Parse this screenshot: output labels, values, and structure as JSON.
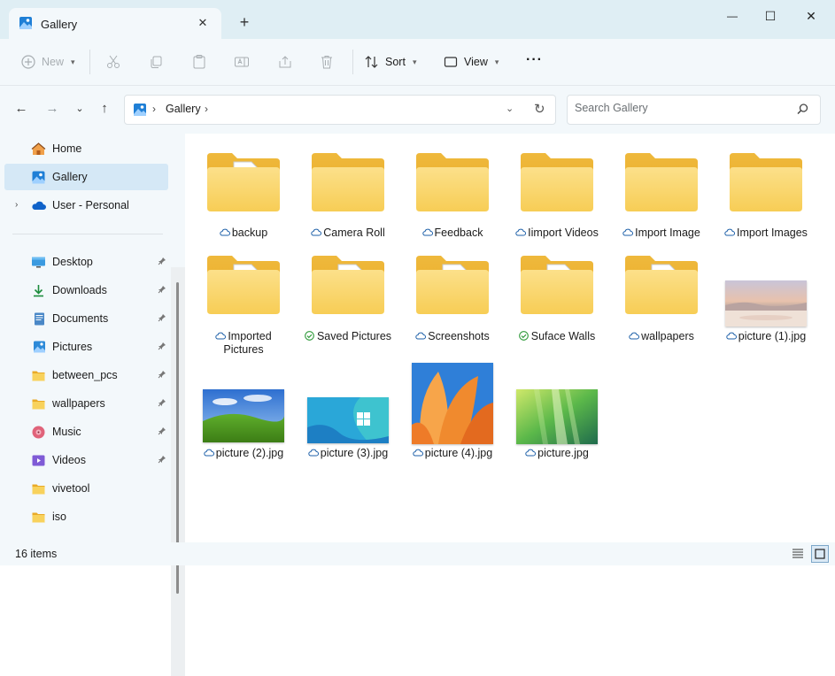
{
  "window": {
    "tab_title": "Gallery",
    "new_tab_glyph": "+",
    "close_tab_glyph": "✕",
    "minimize_glyph": "—",
    "maximize_glyph": "☐",
    "close_glyph": "✕"
  },
  "toolbar": {
    "new_label": "New",
    "sort_label": "Sort",
    "view_label": "View",
    "more_glyph": "···"
  },
  "address": {
    "location": "Gallery",
    "separator": "›"
  },
  "search": {
    "placeholder": "Search Gallery"
  },
  "sidebar": {
    "items": [
      {
        "label": "Home",
        "icon": "home-icon"
      },
      {
        "label": "Gallery",
        "icon": "gallery-icon",
        "selected": true
      },
      {
        "label": "User - Personal",
        "icon": "onedrive-icon"
      },
      {
        "label": "Desktop",
        "icon": "desktop-icon",
        "pinned": true
      },
      {
        "label": "Downloads",
        "icon": "downloads-icon",
        "pinned": true
      },
      {
        "label": "Documents",
        "icon": "documents-icon",
        "pinned": true
      },
      {
        "label": "Pictures",
        "icon": "pictures-icon",
        "pinned": true
      },
      {
        "label": "between_pcs",
        "icon": "folder-icon",
        "pinned": true
      },
      {
        "label": "wallpapers",
        "icon": "folder-icon",
        "pinned": true
      },
      {
        "label": "Music",
        "icon": "music-icon",
        "pinned": true
      },
      {
        "label": "Videos",
        "icon": "videos-icon",
        "pinned": true
      },
      {
        "label": "vivetool",
        "icon": "folder-icon"
      },
      {
        "label": "iso",
        "icon": "folder-icon"
      }
    ]
  },
  "items": [
    {
      "name": "backup",
      "kind": "folder-doc",
      "status": "cloud"
    },
    {
      "name": "Camera Roll",
      "kind": "folder",
      "status": "cloud"
    },
    {
      "name": "Feedback",
      "kind": "folder",
      "status": "cloud"
    },
    {
      "name": "Iimport Videos",
      "kind": "folder",
      "status": "cloud"
    },
    {
      "name": "Import Image",
      "kind": "folder",
      "status": "cloud"
    },
    {
      "name": "Import Images",
      "kind": "folder",
      "status": "cloud"
    },
    {
      "name": "Imported",
      "name2": "Pictures",
      "kind": "folder-doc",
      "status": "cloud"
    },
    {
      "name": "Saved Pictures",
      "kind": "folder-doc",
      "status": "synced"
    },
    {
      "name": "Screenshots",
      "kind": "folder-doc",
      "status": "cloud"
    },
    {
      "name": "Suface Walls",
      "kind": "folder-doc",
      "status": "synced"
    },
    {
      "name": "wallpapers",
      "kind": "folder-doc",
      "status": "cloud"
    },
    {
      "name": "picture (1).jpg",
      "kind": "image",
      "status": "cloud"
    },
    {
      "name": "picture (2).jpg",
      "kind": "image",
      "status": "cloud"
    },
    {
      "name": "picture (3).jpg",
      "kind": "image",
      "status": "cloud"
    },
    {
      "name": "picture (4).jpg",
      "kind": "image",
      "status": "cloud"
    },
    {
      "name": "picture.jpg",
      "kind": "image",
      "status": "cloud"
    }
  ],
  "status": {
    "count": "16 items"
  },
  "colors": {
    "accent": "#0067c0",
    "folder": "#f8d25c",
    "synced": "#2f9a3a",
    "selected_bg": "#d5e8f6"
  }
}
